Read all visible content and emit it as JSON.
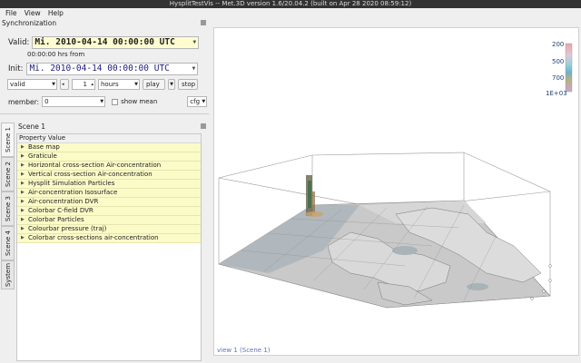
{
  "window": {
    "title": "HysplitTestVis -- Met.3D version 1.6/20.04.2 (built on Apr 28 2020 08:59:12)"
  },
  "menu": {
    "file": "File",
    "view": "View",
    "help": "Help"
  },
  "sync": {
    "section_label": "Synchronization",
    "valid_label": "Valid:",
    "valid_value": "Mi. 2010-04-14 00:00:00 UTC",
    "hours_from": "00:00:00 hrs from",
    "init_label": "Init:",
    "init_value": "Mi. 2010-04-14 00:00:00 UTC",
    "mode_value": "valid",
    "step_value": "1",
    "unit_value": "hours",
    "play_label": "play",
    "stop_label": "stop",
    "member_label": "member:",
    "member_value": "0",
    "show_mean_label": "show mean",
    "cfg_label": "cfg"
  },
  "scene": {
    "title": "Scene 1",
    "tabs": [
      "Scene 1",
      "Scene 2",
      "Scene 3",
      "Scene 4",
      "System"
    ],
    "header": "Property  Value",
    "items": [
      "Base map",
      "Graticule",
      "Horizontal cross-section Air-concentration",
      "Vertical cross-section Air-concentration",
      "Hysplit Simulation Particles",
      "Air-concentration Isosurface",
      "Air-concentration DVR",
      "Colorbar C-field DVR",
      "Colorbar Particles",
      "Colourbar pressure (traj)",
      "Colorbar cross-sections air-concentration"
    ]
  },
  "view": {
    "label": "view 1 (Scene 1)",
    "colorbar_ticks": [
      "200",
      "500",
      "700",
      "1E+03"
    ]
  },
  "colors": {
    "valid_bg": "#fffdd0",
    "tree_item_bg": "#fbfbc8",
    "view_label": "#6070b0"
  }
}
